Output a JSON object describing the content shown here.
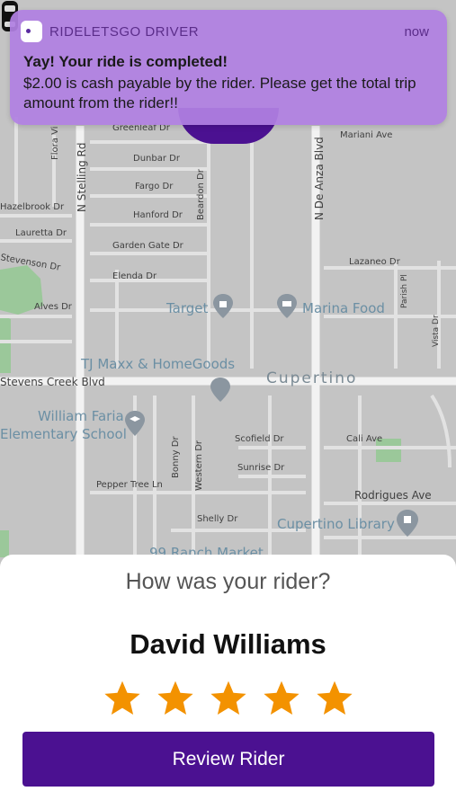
{
  "notification": {
    "app_name": "RIDELETSGO DRIVER",
    "time": "now",
    "title": "Yay! Your ride is completed!",
    "body": "$2.00 is cash payable by the rider. Please get the total trip amount from the rider!!"
  },
  "map": {
    "streets": {
      "greenleaf": "Greenleaf Dr",
      "mariani": "Mariani Ave",
      "flora_vista": "Flora Vi",
      "stelling": "N Stelling Rd",
      "de_anza": "N De Anza Blvd",
      "dunbar": "Dunbar Dr",
      "fargo": "Fargo Dr",
      "hazelbrook": "Hazelbrook Dr",
      "hanford": "Hanford Dr",
      "beardon": "Beardon Dr",
      "lauretta": "Lauretta Dr",
      "garden_gate": "Garden Gate Dr",
      "lazaneo": "Lazaneo Dr",
      "stevenson": "Stevenson Dr",
      "elenda": "Elenda Dr",
      "parish": "Parish Pl",
      "alves": "Alves Dr",
      "vista": "Vista Dr",
      "stevens_creek": "Stevens Creek Blvd",
      "scofield": "Scofield Dr",
      "cali": "Cali Ave",
      "bonny": "Bonny Dr",
      "western": "Western Dr",
      "sunrise": "Sunrise Dr",
      "pepper_tree": "Pepper Tree Ln",
      "rodrigues": "Rodrigues Ave",
      "shelly": "Shelly Dr"
    },
    "pois": {
      "target": "Target",
      "marina": "Marina Food",
      "tjmaxx": "TJ Maxx & HomeGoods",
      "cupertino": "Cupertino",
      "william_faria_1": "William Faria",
      "william_faria_2": "Elementary School",
      "library": "Cupertino Library",
      "ranch": "99 Ranch Market"
    }
  },
  "rating": {
    "question": "How was your rider?",
    "rider_name": "David Williams",
    "stars": 5,
    "max_stars": 5,
    "button_label": "Review Rider"
  },
  "colors": {
    "brand": "#4b1191",
    "star": "#f39200",
    "notification_bg": "#b080e2"
  }
}
